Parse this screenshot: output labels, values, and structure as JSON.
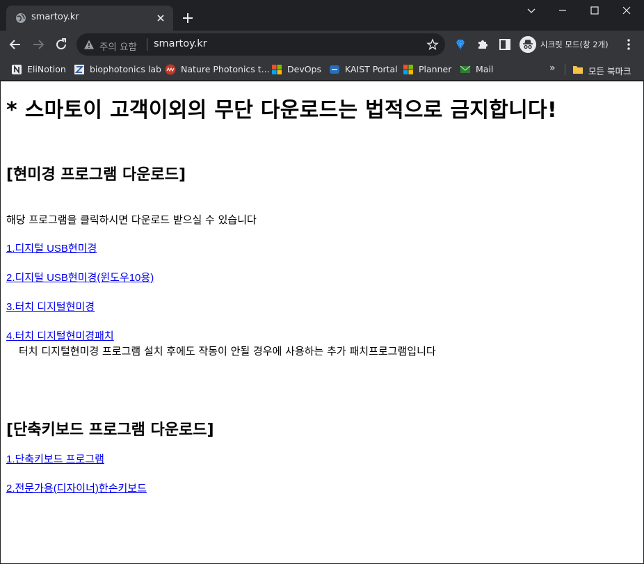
{
  "browser": {
    "tab_title": "smartoy.kr",
    "omnibox": {
      "security_status": "주의 요함",
      "url": "smartoy.kr"
    },
    "incognito_label": "시크릿 모드(창 2개)",
    "bookmarks": [
      {
        "label": "EliNotion",
        "icon": "notion-icon"
      },
      {
        "label": "biophotonics lab",
        "icon": "zotero-icon"
      },
      {
        "label": "Nature Photonics t...",
        "icon": "nature-photonics-icon"
      },
      {
        "label": "DevOps",
        "icon": "microsoft-icon"
      },
      {
        "label": "KAIST Portal",
        "icon": "kaist-icon"
      },
      {
        "label": "Planner",
        "icon": "microsoft-icon"
      },
      {
        "label": "Mail",
        "icon": "mail-icon"
      }
    ],
    "bookmarks_more": "»",
    "all_bookmarks": "모든 북마크"
  },
  "page": {
    "warning_heading": "* 스마토이 고객이외의 무단 다운로드는 법적으로 금지합니다!",
    "microscope_heading": "[현미경 프로그램 다운로드]",
    "microscope_intro": "해당 프로그램을 클릭하시면 다운로드 받으실 수 있습니다",
    "microscope_links": [
      "1.디지털 USB현미경",
      "2.디지털 USB현미경(윈도우10용)",
      "3.터치 디지털현미경",
      "4.터치 디지털현미경패치"
    ],
    "patch_note": "터치 디지털현미경 프로그램 설치 후에도 작동이 안될 경우에 사용하는 추가 패치프로그램입니다",
    "keyboard_heading": "[단축키보드 프로그램 다운로드]",
    "keyboard_links": [
      "1.단축키보드 프로그램",
      "2.전문가용(디자이너)한손키보드"
    ]
  },
  "colors": {
    "chrome_dark": "#202124",
    "chrome_toolbar": "#35363a",
    "link": "#0000ee"
  }
}
